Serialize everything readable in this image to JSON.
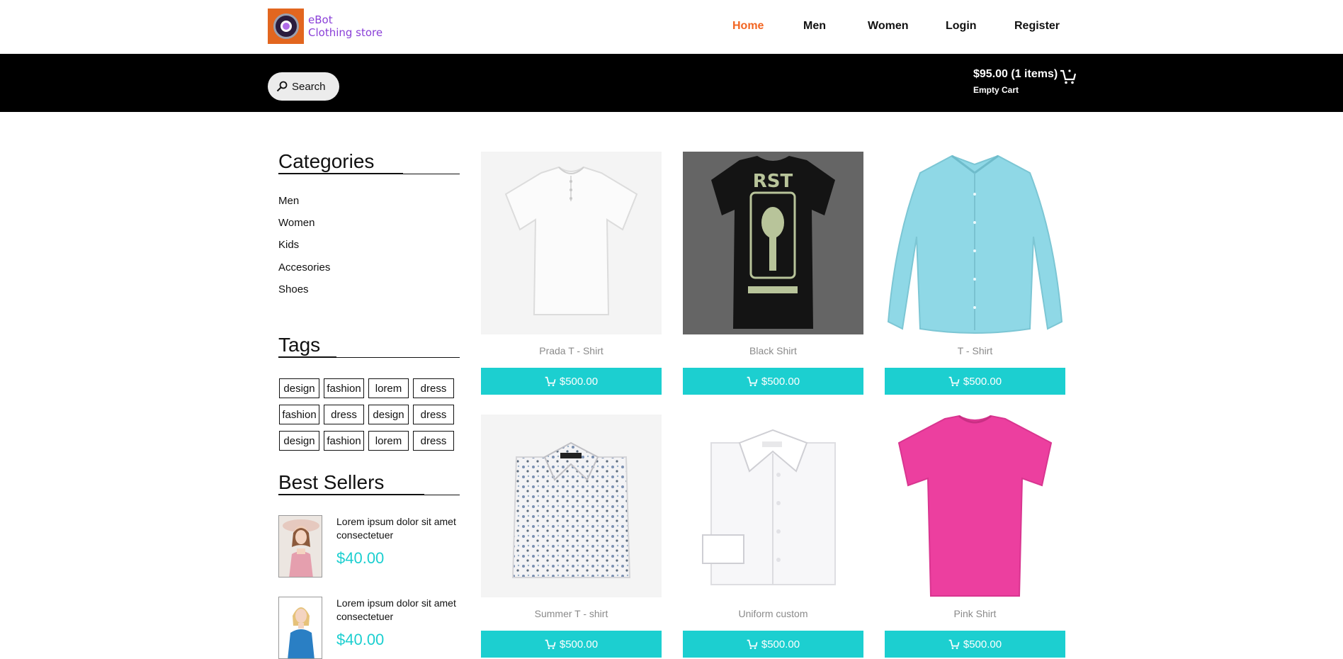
{
  "brand": {
    "line1": "eBot",
    "line2": "Clothing store"
  },
  "nav": [
    {
      "label": "Home",
      "active": true
    },
    {
      "label": "Men",
      "active": false
    },
    {
      "label": "Women",
      "active": false
    },
    {
      "label": "Login",
      "active": false
    },
    {
      "label": "Register",
      "active": false
    }
  ],
  "search": {
    "label": "Search"
  },
  "cart": {
    "total": "$95.00 (1 items)",
    "empty_label": "Empty Cart"
  },
  "sidebar": {
    "categories_title": "Categories",
    "categories": [
      "Men",
      "Women",
      "Kids",
      "Accesories",
      "Shoes"
    ],
    "tags_title": "Tags",
    "tags": [
      [
        "design",
        "fashion",
        "lorem",
        "dress"
      ],
      [
        "fashion",
        "dress",
        "design",
        "dress"
      ],
      [
        "design",
        "fashion",
        "lorem",
        "dress"
      ]
    ],
    "best_sellers_title": "Best Sellers",
    "best_sellers": [
      {
        "text": "Lorem ipsum dolor sit amet consectetuer",
        "price": "$40.00"
      },
      {
        "text": "Lorem ipsum dolor sit amet consectetuer",
        "price": "$40.00"
      }
    ]
  },
  "products": [
    {
      "name": "Prada T - Shirt",
      "price": "$500.00"
    },
    {
      "name": "Black Shirt",
      "price": "$500.00"
    },
    {
      "name": "T - Shirt",
      "price": "$500.00"
    },
    {
      "name": "Summer T - shirt",
      "price": "$500.00"
    },
    {
      "name": "Uniform custom",
      "price": "$500.00"
    },
    {
      "name": "Pink Shirt",
      "price": "$500.00"
    }
  ],
  "colors": {
    "accent": "#1ccfd0",
    "active_nav": "#f26522",
    "brand": "#8a3fd8"
  }
}
